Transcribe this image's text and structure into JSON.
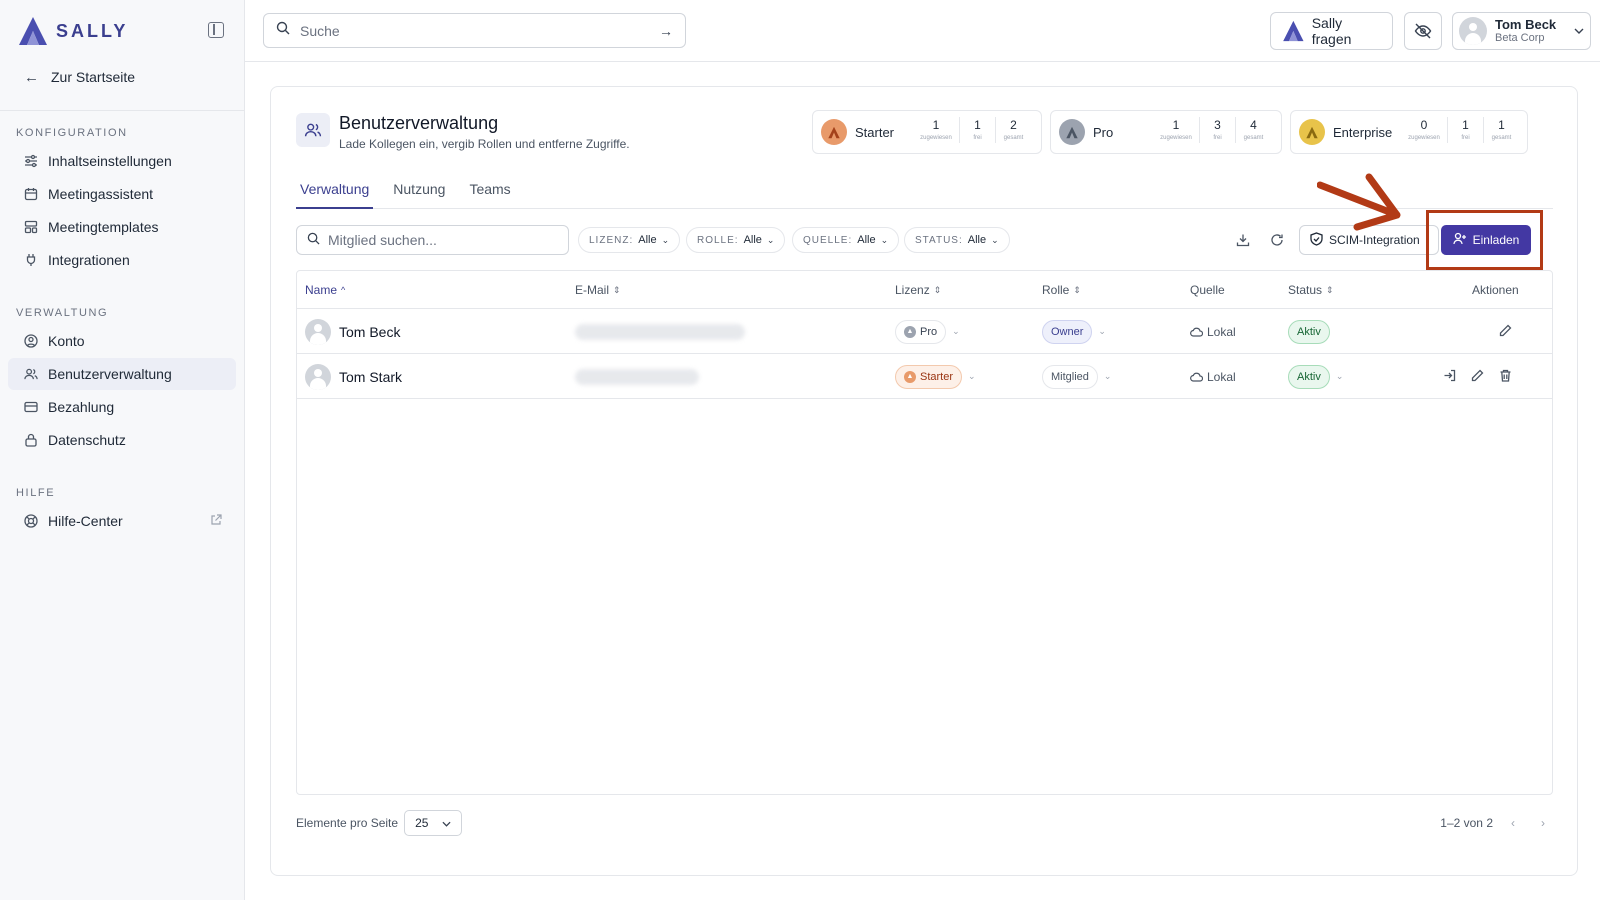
{
  "brand": {
    "name": "SALLY",
    "color": "#3b3f8f"
  },
  "sidebar": {
    "back_label": "Zur Startseite",
    "sections": [
      {
        "title": "KONFIGURATION",
        "items": [
          {
            "label": "Inhaltseinstellungen",
            "icon": "sliders-icon"
          },
          {
            "label": "Meetingassistent",
            "icon": "calendar-icon"
          },
          {
            "label": "Meetingtemplates",
            "icon": "template-icon"
          },
          {
            "label": "Integrationen",
            "icon": "plug-icon"
          }
        ]
      },
      {
        "title": "VERWALTUNG",
        "items": [
          {
            "label": "Konto",
            "icon": "user-circle-icon"
          },
          {
            "label": "Benutzerverwaltung",
            "icon": "users-icon",
            "active": true
          },
          {
            "label": "Bezahlung",
            "icon": "credit-card-icon"
          },
          {
            "label": "Datenschutz",
            "icon": "lock-icon"
          }
        ]
      },
      {
        "title": "HILFE",
        "items": [
          {
            "label": "Hilfe-Center",
            "icon": "lifebuoy-icon",
            "external": true
          }
        ]
      }
    ]
  },
  "topbar": {
    "search_placeholder": "Suche",
    "ask_label": "Sally fragen",
    "user_name": "Tom Beck",
    "user_org": "Beta Corp"
  },
  "page": {
    "title": "Benutzerverwaltung",
    "subtitle": "Lade Kollegen ein, vergib Rollen und entferne Zugriffe."
  },
  "licenses": [
    {
      "name": "Starter",
      "assigned": "1",
      "free": "1",
      "total": "2",
      "color": "#e89a6a"
    },
    {
      "name": "Pro",
      "assigned": "1",
      "free": "3",
      "total": "4",
      "color": "#9ca3af"
    },
    {
      "name": "Enterprise",
      "assigned": "0",
      "free": "1",
      "total": "1",
      "color": "#e8c34a"
    }
  ],
  "license_stat_labels": {
    "assigned": "zugewiesen",
    "free": "frei",
    "total": "gesamt"
  },
  "tabs": [
    "Verwaltung",
    "Nutzung",
    "Teams"
  ],
  "toolbar": {
    "member_search_placeholder": "Mitglied suchen...",
    "filters": [
      {
        "label": "LIZENZ:",
        "value": "Alle"
      },
      {
        "label": "ROLLE:",
        "value": "Alle"
      },
      {
        "label": "QUELLE:",
        "value": "Alle"
      },
      {
        "label": "STATUS:",
        "value": "Alle"
      }
    ],
    "scim_label": "SCIM-Integration",
    "invite_label": "Einladen",
    "invite_color": "#4338a3",
    "highlight_color": "#b23a16"
  },
  "table": {
    "columns": {
      "name": "Name",
      "email": "E-Mail",
      "license": "Lizenz",
      "role": "Rolle",
      "source": "Quelle",
      "status": "Status",
      "actions": "Aktionen"
    },
    "rows": [
      {
        "name": "Tom Beck",
        "license": "Pro",
        "role": "Owner",
        "source": "Lokal",
        "status": "Aktiv"
      },
      {
        "name": "Tom Stark",
        "license": "Starter",
        "role": "Mitglied",
        "source": "Lokal",
        "status": "Aktiv"
      }
    ]
  },
  "pagination": {
    "per_page_label": "Elemente pro Seite",
    "per_page_value": "25",
    "range": "1–2 von 2"
  }
}
